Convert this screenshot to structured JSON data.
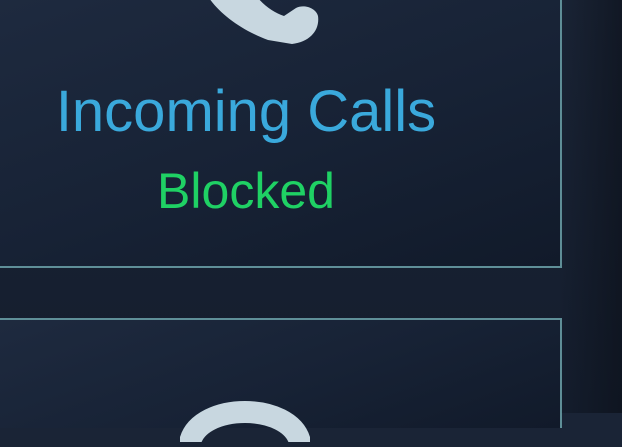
{
  "cards": [
    {
      "icon": "phone-icon",
      "title": "Incoming Calls",
      "status": "Blocked",
      "status_color": "#1fd164",
      "title_color": "#3aa9dc"
    },
    {
      "icon": "phone-icon"
    }
  ],
  "colors": {
    "background": "#18223a",
    "card_border": "#5f8f98",
    "icon": "#c8d7e0"
  }
}
